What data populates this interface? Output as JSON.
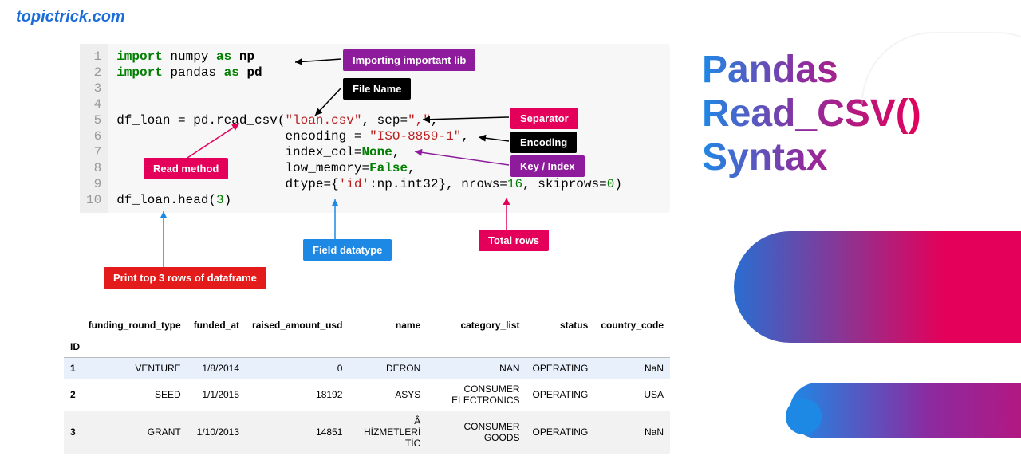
{
  "site": {
    "title": "topictrick.com"
  },
  "code": {
    "lines": [
      "1",
      "2",
      "3",
      "4",
      "5",
      "6",
      "7",
      "8",
      "9",
      "10"
    ],
    "import1a": "import",
    "import1b": "numpy",
    "import1c": "as",
    "import1d": "np",
    "import2a": "import",
    "import2b": "pandas",
    "import2c": "as",
    "import2d": "pd",
    "l5a": "df_loan = pd.read_csv(",
    "l5b": "\"loan.csv\"",
    "l5c": ", sep=",
    "l5d": "\",\"",
    "l5e": ",",
    "l6a": "                      encoding = ",
    "l6b": "\"ISO-8859-1\"",
    "l6c": ",",
    "l7a": "                      index_col=",
    "l7b": "None",
    "l7c": ",",
    "l8a": "                      low_memory=",
    "l8b": "False",
    "l8c": ",",
    "l9a": "                      dtype={",
    "l9b": "'id'",
    "l9c": ":np.int32}, nrows=",
    "l9d": "16",
    "l9e": ", skiprows=",
    "l9f": "0",
    "l9g": ")",
    "l10a": "df_loan.head(",
    "l10b": "3",
    "l10c": ")"
  },
  "labels": {
    "importlib": "Importing important lib",
    "filename": "File Name",
    "separator": "Separator",
    "encoding": "Encoding",
    "keyindex": "Key / Index",
    "readmethod": "Read method",
    "totalrows": "Total rows",
    "datatype": "Field datatype",
    "printtop": "Print top 3 rows of dataframe"
  },
  "table": {
    "idheader": "ID",
    "headers": [
      "funding_round_type",
      "funded_at",
      "raised_amount_usd",
      "name",
      "category_list",
      "status",
      "country_code"
    ],
    "rows": [
      {
        "id": "1",
        "cells": [
          "VENTURE",
          "1/8/2014",
          "0",
          "DERON",
          "NAN",
          "OPERATING",
          "NaN"
        ]
      },
      {
        "id": "2",
        "cells": [
          "SEED",
          "1/1/2015",
          "18192",
          "ASYS",
          "CONSUMER ELECTRONICS",
          "OPERATING",
          "USA"
        ]
      },
      {
        "id": "3",
        "cells": [
          "GRANT",
          "1/10/2013",
          "14851",
          "Â HİZMETLERİ TİC",
          "CONSUMER GOODS",
          "OPERATING",
          "NaN"
        ]
      }
    ]
  },
  "heading": {
    "l1": "Pandas",
    "l2": "Read_CSV()",
    "l3": "Syntax"
  }
}
